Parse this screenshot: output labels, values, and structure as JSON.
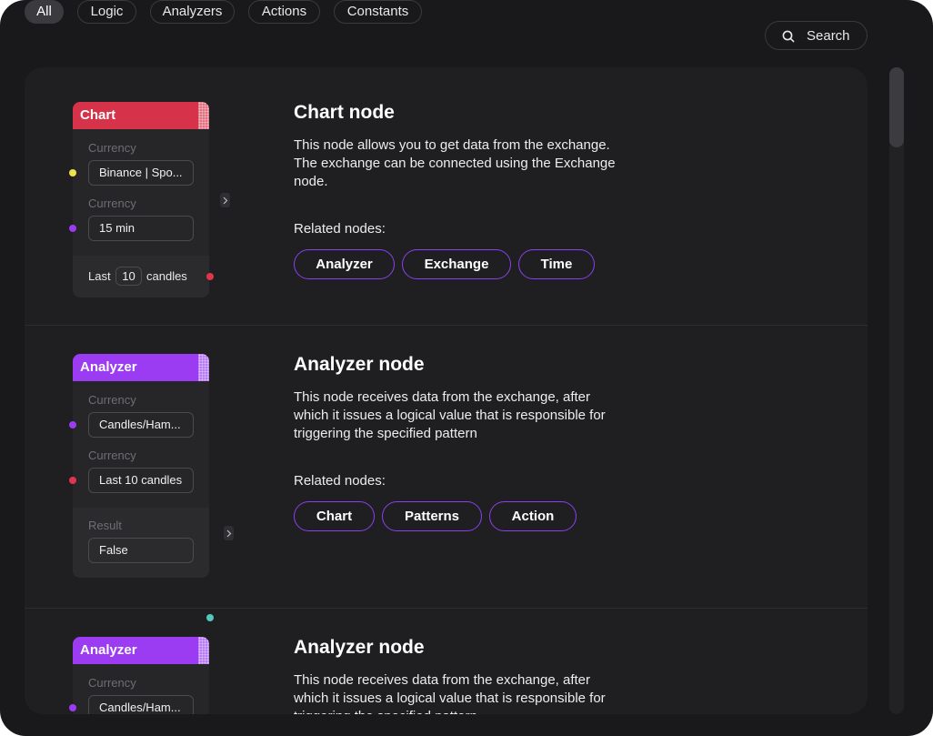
{
  "filters": [
    "All",
    "Logic",
    "Analyzers",
    "Actions",
    "Constants"
  ],
  "active_filter": "All",
  "search": {
    "label": "Search",
    "icon": "search-icon"
  },
  "colors": {
    "accent": "#8a3ff0",
    "chart_node": "#d6334a",
    "analyzer_node": "#9b3cf2",
    "background": "#19191b"
  },
  "related_label": "Related nodes:",
  "entries": [
    {
      "title": "Chart node",
      "description": "This node allows you to get data from the exchange. The exchange can be connected using the Exchange node.",
      "related": [
        "Analyzer",
        "Exchange",
        "Time"
      ],
      "card": {
        "header": "Chart",
        "fields": [
          {
            "label": "Currency",
            "value": "Binance | Spo..."
          },
          {
            "label": "Currency",
            "value": "15 min"
          }
        ],
        "footer": {
          "prefix": "Last",
          "number": "10",
          "suffix": "candles"
        }
      }
    },
    {
      "title": "Analyzer node",
      "description": "This node receives data from the exchange, after which it issues a logical value that is responsible for triggering the specified pattern",
      "related": [
        "Chart",
        "Patterns",
        "Action"
      ],
      "card": {
        "header": "Analyzer",
        "fields": [
          {
            "label": "Currency",
            "value": "Candles/Ham..."
          },
          {
            "label": "Currency",
            "value": "Last 10 candles"
          }
        ],
        "result": {
          "label": "Result",
          "value": "False"
        }
      }
    },
    {
      "title": "Analyzer node",
      "description": "This node receives data from the exchange, after which it issues a logical value that is responsible for triggering the specified pattern",
      "card": {
        "header": "Analyzer",
        "fields": [
          {
            "label": "Currency",
            "value": "Candles/Ham..."
          }
        ]
      }
    }
  ]
}
